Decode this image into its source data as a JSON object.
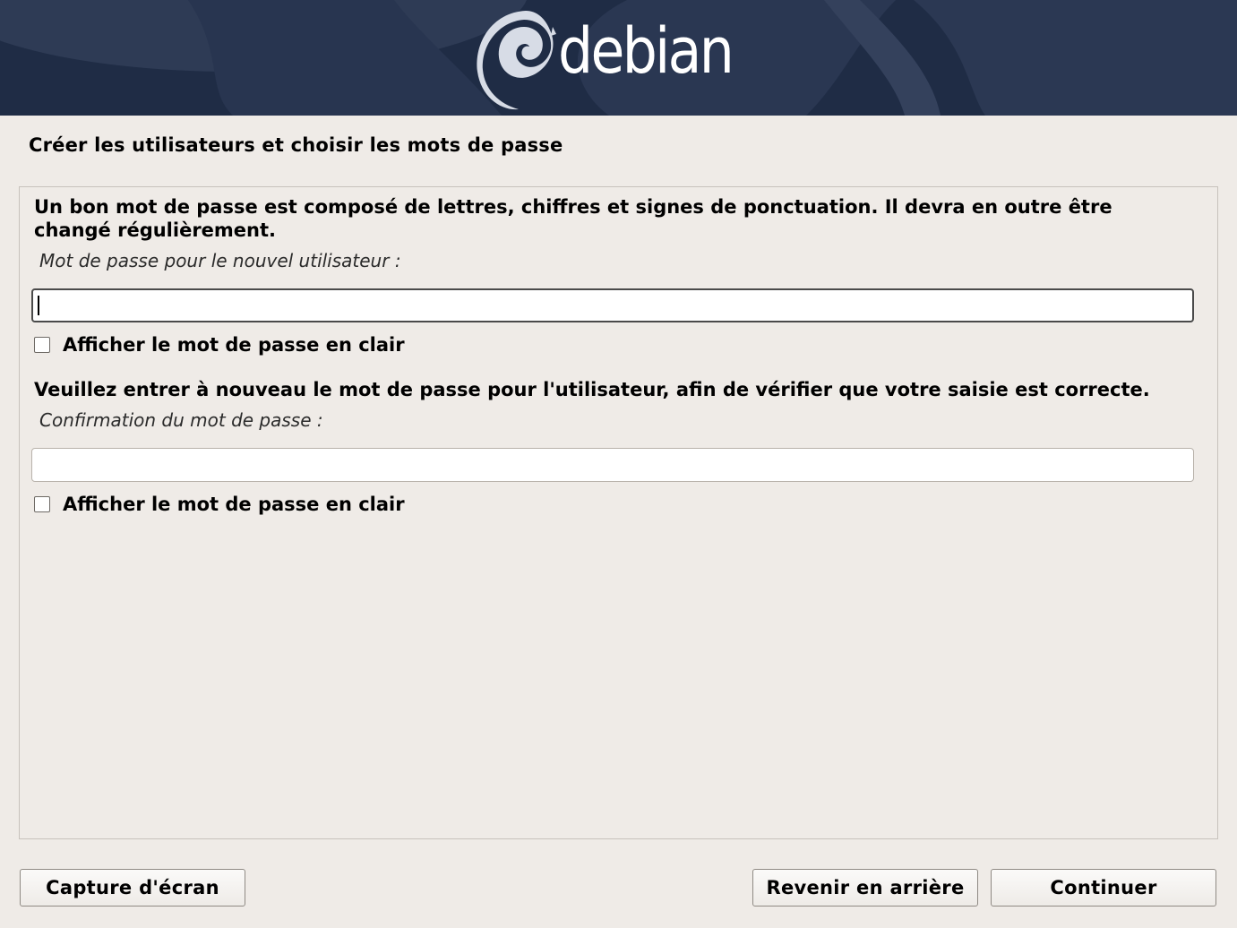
{
  "banner": {
    "logo_text": "debian"
  },
  "page": {
    "title": "Créer les utilisateurs et choisir les mots de passe"
  },
  "form": {
    "description1": "Un bon mot de passe est composé de lettres, chiffres et signes de ponctuation. Il devra en outre être changé régulièrement.",
    "password_label": "Mot de passe pour le nouvel utilisateur :",
    "password_value": "",
    "show_password_label_1": "Afficher le mot de passe en clair",
    "description2": "Veuillez entrer à nouveau le mot de passe pour l'utilisateur, afin de vérifier que votre saisie est correcte.",
    "confirm_label": "Confirmation du mot de passe :",
    "confirm_value": "",
    "show_password_label_2": "Afficher le mot de passe en clair"
  },
  "buttons": {
    "screenshot": "Capture d'écran",
    "back": "Revenir en arrière",
    "continue": "Continuer"
  },
  "colors": {
    "banner": "#1f2c45",
    "background": "#efebe7"
  },
  "icons": {
    "logo": "debian-swirl-icon",
    "checkbox": "checkbox-icon"
  }
}
